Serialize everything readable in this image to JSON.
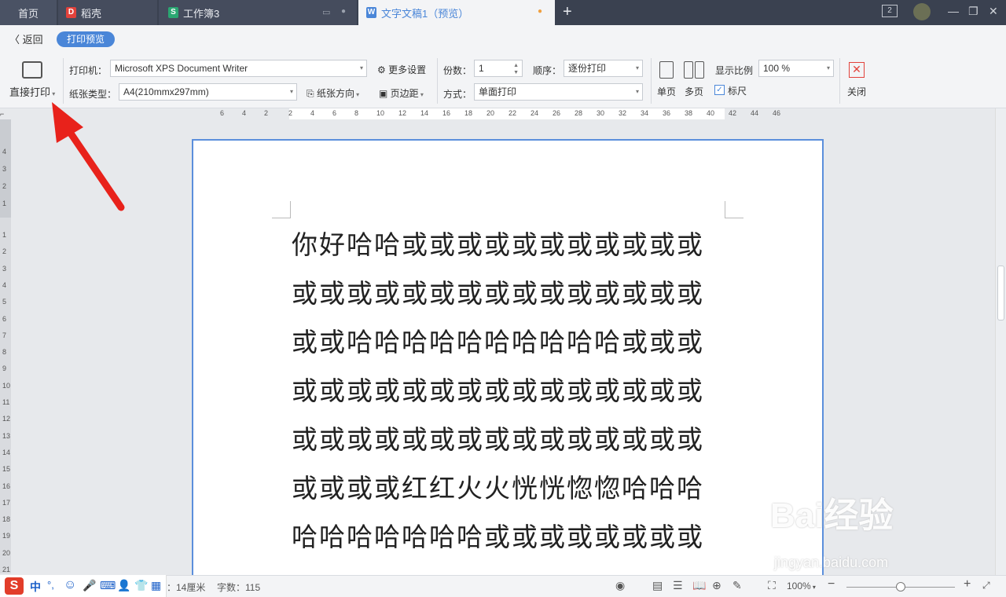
{
  "tabs": [
    {
      "label": "首页"
    },
    {
      "label": "稻壳"
    },
    {
      "label": "工作簿3"
    },
    {
      "label": "文字文稿1（预览）"
    }
  ],
  "window": {
    "badge": "2"
  },
  "toolbar": {
    "back": "返回",
    "preview_label": "打印预览",
    "direct_print": "直接打印",
    "printer_label": "打印机：",
    "printer_value": "Microsoft XPS Document Writer",
    "more_settings": "更多设置",
    "paper_type_label": "纸张类型：",
    "paper_type_value": "A4(210mmx297mm)",
    "paper_direction": "纸张方向",
    "margins": "页边距",
    "copies_label": "份数：",
    "copies_value": "1",
    "order_label": "顺序：",
    "order_value": "逐份打印",
    "mode_label": "方式：",
    "mode_value": "单面打印",
    "single_page": "单页",
    "multi_page": "多页",
    "zoom_label": "显示比例",
    "zoom_value": "100 %",
    "ruler_label": "标尺",
    "close": "关闭"
  },
  "ruler_top": [
    "6",
    "4",
    "2",
    "2",
    "4",
    "6",
    "8",
    "10",
    "12",
    "14",
    "16",
    "18",
    "20",
    "22",
    "24",
    "26",
    "28",
    "30",
    "32",
    "34",
    "36",
    "38",
    "40",
    "42",
    "44",
    "46"
  ],
  "ruler_left": [
    "4",
    "3",
    "2",
    "1",
    "1",
    "2",
    "3",
    "4",
    "5",
    "6",
    "7",
    "8",
    "9",
    "10",
    "11",
    "12",
    "13",
    "14",
    "15",
    "16",
    "17",
    "18",
    "19",
    "20",
    "21"
  ],
  "document": {
    "lines": [
      "你好哈哈或或或或或或或或或或或",
      "或或或或或或或或或或或或或或或",
      "或或哈哈哈哈哈哈哈哈哈哈或或或",
      "或或或或或或或或或或或或或或或",
      "或或或或或或或或或或或或或或或",
      "或或或或红红火火恍恍惚惚哈哈哈",
      "哈哈哈哈哈哈哈或或或或或或或或"
    ]
  },
  "status": {
    "page_info": "值：14厘米",
    "word_count": "字数：115",
    "zoom": "100%"
  },
  "ime": {
    "mode": "中"
  },
  "watermark": {
    "brand": "Bai经验",
    "url": "jingyan.baidu.com"
  },
  "colors": {
    "accent": "#4a86d8",
    "tabbar": "#3a4150",
    "arrow": "#e8221b"
  }
}
